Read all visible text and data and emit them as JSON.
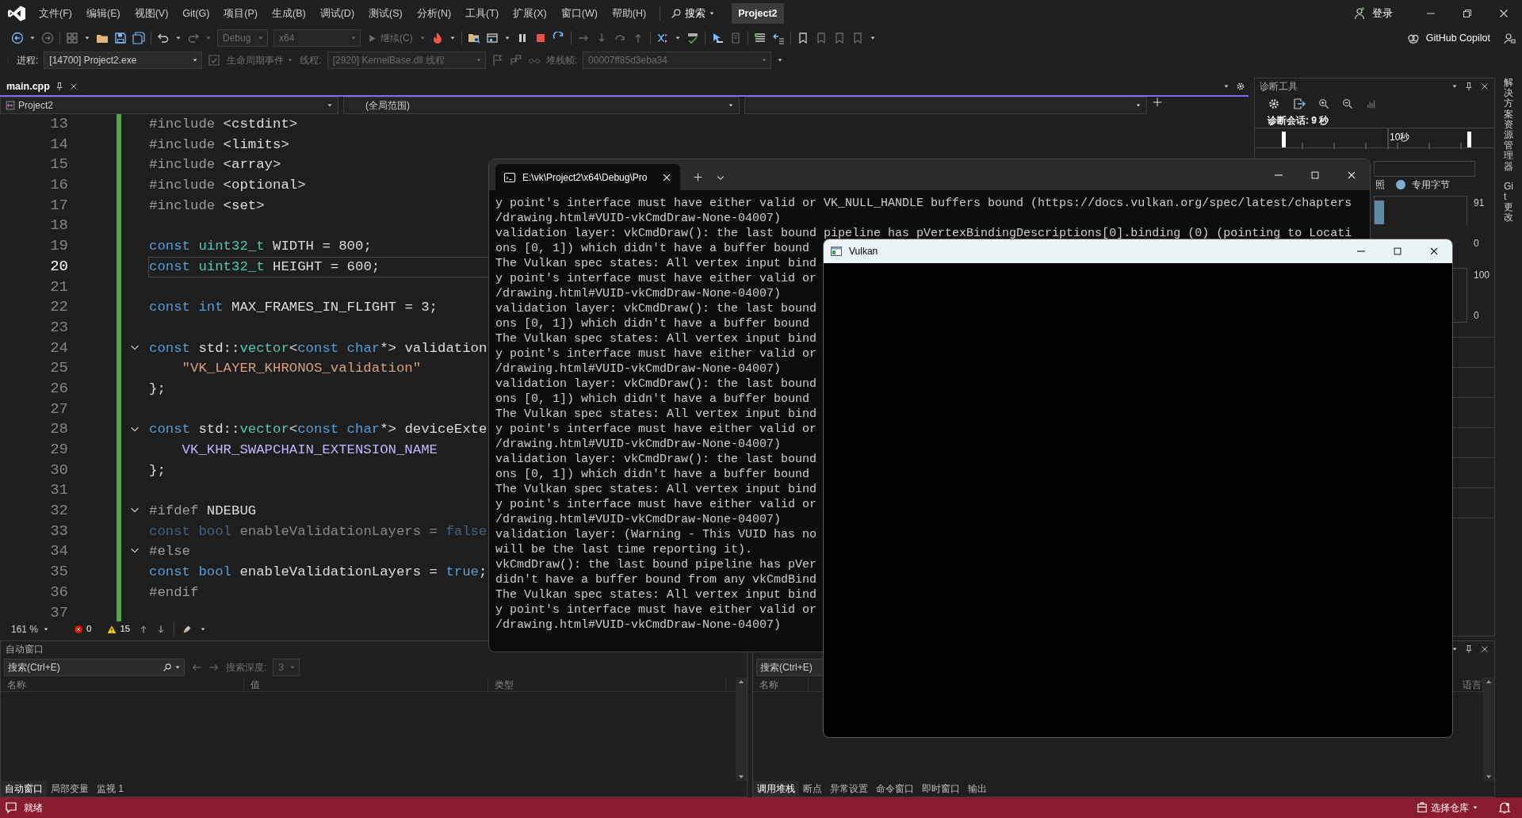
{
  "menu_bar": {
    "items": [
      "文件(F)",
      "编辑(E)",
      "视图(V)",
      "Git(G)",
      "项目(P)",
      "生成(B)",
      "调试(D)",
      "测试(S)",
      "分析(N)",
      "工具(T)",
      "扩展(X)",
      "窗口(W)",
      "帮助(H)"
    ],
    "search": "搜索",
    "solution": "Project2",
    "sign_in": "登录"
  },
  "toolbar": {
    "configuration": "Debug",
    "platform": "x64",
    "continue": "继续(C)",
    "copilot": "GitHub Copilot"
  },
  "debug_location": {
    "process_label": "进程:",
    "process": "[14700] Project2.exe",
    "lifecycle": "生命周期事件",
    "thread_label": "线程:",
    "thread": "[2920] KernelBase.dll 线程",
    "stack_label": "堆栈帧:",
    "stack_frame": "00007ff85d3eba34"
  },
  "editor": {
    "tabs": [
      {
        "label": "main.cpp",
        "selected": true
      }
    ],
    "navigation": {
      "project": "Project2",
      "scope": "(全局范围)"
    },
    "lines": [
      {
        "number": "13",
        "current": false,
        "fold": false,
        "inactive": false,
        "tokens": [
          {
            "kind": "preproc",
            "text": "#include"
          },
          {
            "kind": "plain",
            "text": " <cstdint>"
          }
        ]
      },
      {
        "number": "14",
        "current": false,
        "fold": false,
        "inactive": false,
        "tokens": [
          {
            "kind": "preproc",
            "text": "#include"
          },
          {
            "kind": "plain",
            "text": " <limits>"
          }
        ]
      },
      {
        "number": "15",
        "current": false,
        "fold": false,
        "inactive": false,
        "tokens": [
          {
            "kind": "preproc",
            "text": "#include"
          },
          {
            "kind": "plain",
            "text": " <array>"
          }
        ]
      },
      {
        "number": "16",
        "current": false,
        "fold": false,
        "inactive": false,
        "tokens": [
          {
            "kind": "preproc",
            "text": "#include"
          },
          {
            "kind": "plain",
            "text": " <optional>"
          }
        ]
      },
      {
        "number": "17",
        "current": false,
        "fold": false,
        "inactive": false,
        "tokens": [
          {
            "kind": "preproc",
            "text": "#include"
          },
          {
            "kind": "plain",
            "text": " <set>"
          }
        ]
      },
      {
        "number": "18",
        "current": false,
        "fold": false,
        "inactive": false
      },
      {
        "number": "19",
        "current": false,
        "fold": false,
        "inactive": false,
        "tokens": [
          {
            "kind": "keyword",
            "text": "const"
          },
          {
            "kind": "type",
            "text": " uint32_t"
          },
          {
            "kind": "plain",
            "text": " WIDTH = 800;"
          }
        ]
      },
      {
        "number": "20",
        "current": true,
        "fold": false,
        "inactive": false,
        "tokens": [
          {
            "kind": "keyword",
            "text": "const"
          },
          {
            "kind": "type",
            "text": " uint32_t"
          },
          {
            "kind": "plain",
            "text": " HEIGHT = 600;"
          }
        ]
      },
      {
        "number": "21",
        "current": false,
        "fold": false,
        "inactive": false
      },
      {
        "number": "22",
        "current": false,
        "fold": false,
        "inactive": false,
        "tokens": [
          {
            "kind": "keyword",
            "text": "const"
          },
          {
            "kind": "keyword",
            "text": " int"
          },
          {
            "kind": "plain",
            "text": " MAX_FRAMES_IN_FLIGHT = 3;"
          }
        ]
      },
      {
        "number": "23",
        "current": false,
        "fold": false,
        "inactive": false
      },
      {
        "number": "24",
        "current": false,
        "fold": true,
        "inactive": false,
        "tokens": [
          {
            "kind": "keyword",
            "text": "const"
          },
          {
            "kind": "plain",
            "text": " std::"
          },
          {
            "kind": "type",
            "text": "vector"
          },
          {
            "kind": "plain",
            "text": "<"
          },
          {
            "kind": "keyword",
            "text": "const"
          },
          {
            "kind": "keyword",
            "text": " char"
          },
          {
            "kind": "plain",
            "text": "*> validation"
          }
        ]
      },
      {
        "number": "25",
        "current": false,
        "fold": false,
        "inactive": false,
        "tokens": [
          {
            "kind": "string",
            "text": "    \"VK_LAYER_KHRONOS_validation\""
          }
        ]
      },
      {
        "number": "26",
        "current": false,
        "fold": false,
        "inactive": false,
        "tokens": [
          {
            "kind": "plain",
            "text": "};"
          }
        ]
      },
      {
        "number": "27",
        "current": false,
        "fold": false,
        "inactive": false
      },
      {
        "number": "28",
        "current": false,
        "fold": true,
        "inactive": false,
        "tokens": [
          {
            "kind": "keyword",
            "text": "const"
          },
          {
            "kind": "plain",
            "text": " std::"
          },
          {
            "kind": "type",
            "text": "vector"
          },
          {
            "kind": "plain",
            "text": "<"
          },
          {
            "kind": "keyword",
            "text": "const"
          },
          {
            "kind": "keyword",
            "text": " char"
          },
          {
            "kind": "plain",
            "text": "*> deviceExte"
          }
        ]
      },
      {
        "number": "29",
        "current": false,
        "fold": false,
        "inactive": false,
        "tokens": [
          {
            "kind": "macro",
            "text": "    VK_KHR_SWAPCHAIN_EXTENSION_NAME"
          }
        ]
      },
      {
        "number": "30",
        "current": false,
        "fold": false,
        "inactive": false,
        "tokens": [
          {
            "kind": "plain",
            "text": "};"
          }
        ]
      },
      {
        "number": "31",
        "current": false,
        "fold": false,
        "inactive": false
      },
      {
        "number": "32",
        "current": false,
        "fold": true,
        "inactive": false,
        "tokens": [
          {
            "kind": "preproc",
            "text": "#ifdef"
          },
          {
            "kind": "plain",
            "text": " NDEBUG"
          }
        ]
      },
      {
        "number": "33",
        "current": false,
        "fold": false,
        "inactive": true,
        "tokens": [
          {
            "kind": "keyword",
            "text": "const"
          },
          {
            "kind": "keyword",
            "text": " bool"
          },
          {
            "kind": "plain",
            "text": " enableValidationLayers = "
          },
          {
            "kind": "keyword",
            "text": "false"
          }
        ]
      },
      {
        "number": "34",
        "current": false,
        "fold": true,
        "inactive": false,
        "tokens": [
          {
            "kind": "preproc",
            "text": "#else"
          }
        ]
      },
      {
        "number": "35",
        "current": false,
        "fold": false,
        "inactive": false,
        "tokens": [
          {
            "kind": "keyword",
            "text": "const"
          },
          {
            "kind": "keyword",
            "text": " bool"
          },
          {
            "kind": "plain",
            "text": " enableValidationLayers = "
          },
          {
            "kind": "keyword",
            "text": "true"
          },
          {
            "kind": "plain",
            "text": ";"
          }
        ]
      },
      {
        "number": "36",
        "current": false,
        "fold": false,
        "inactive": false,
        "tokens": [
          {
            "kind": "preproc",
            "text": "#endif"
          }
        ]
      },
      {
        "number": "37",
        "current": false,
        "fold": false,
        "inactive": false
      }
    ],
    "zoom": "161 %",
    "errors": "0",
    "warnings": "15"
  },
  "diagnostic_tools": {
    "title": "诊断工具",
    "session": "诊断会话: 9 秒",
    "ruler_label": "10秒",
    "legend_1": "照",
    "legend_2": "专用字节",
    "chart_1": {
      "top_label": "91",
      "bottom_label": "0"
    },
    "chart_2": {
      "top_label": "100",
      "bottom_label": "0"
    }
  },
  "autos_panel": {
    "title": "自动窗口",
    "placeholder": "搜索(Ctrl+E)",
    "depth_label": "搜索深度:",
    "depth": "3",
    "columns": [
      "名称",
      "值",
      "类型"
    ],
    "tabs": [
      {
        "label": "自动窗口",
        "selected": true
      },
      {
        "label": "局部变量",
        "selected": false
      },
      {
        "label": "监视 1",
        "selected": false
      }
    ]
  },
  "call_stack_panel": {
    "placeholder": "搜索(Ctrl+E)",
    "columns": [
      "名称",
      "语言"
    ],
    "tabs": [
      {
        "label": "调用堆栈",
        "selected": true
      },
      {
        "label": "断点",
        "selected": false
      },
      {
        "label": "异常设置",
        "selected": false
      },
      {
        "label": "命令窗口",
        "selected": false
      },
      {
        "label": "即时窗口",
        "selected": false
      },
      {
        "label": "输出",
        "selected": false
      }
    ]
  },
  "side_tabs": [
    "解决方案资源管理器",
    "Git 更改"
  ],
  "status_bar": {
    "text": "就绪",
    "repository": "选择仓库"
  },
  "console_window": {
    "tab_title": "E:\\vk\\Project2\\x64\\Debug\\Pro",
    "lines": [
      "y point's interface must have either valid or VK_NULL_HANDLE buffers bound (https://docs.vulkan.org/spec/latest/chapters",
      "/drawing.html#VUID-vkCmdDraw-None-04007)",
      "validation layer: vkCmdDraw(): the last bound pipeline has pVertexBindingDescriptions[0].binding (0) (pointing to Locati",
      "ons [0, 1]) which didn't have a buffer bound",
      "The Vulkan spec states: All vertex input bind",
      "y point's interface must have either valid or",
      "/drawing.html#VUID-vkCmdDraw-None-04007)",
      "validation layer: vkCmdDraw(): the last bound",
      "ons [0, 1]) which didn't have a buffer bound",
      "The Vulkan spec states: All vertex input bind",
      "y point's interface must have either valid or",
      "/drawing.html#VUID-vkCmdDraw-None-04007)",
      "validation layer: vkCmdDraw(): the last bound",
      "ons [0, 1]) which didn't have a buffer bound",
      "The Vulkan spec states: All vertex input bind",
      "y point's interface must have either valid or",
      "/drawing.html#VUID-vkCmdDraw-None-04007)",
      "validation layer: vkCmdDraw(): the last bound",
      "ons [0, 1]) which didn't have a buffer bound",
      "The Vulkan spec states: All vertex input bind",
      "y point's interface must have either valid or",
      "/drawing.html#VUID-vkCmdDraw-None-04007)",
      "validation layer: (Warning - This VUID has no",
      "will be the last time reporting it).",
      "vkCmdDraw(): the last bound pipeline has pVer",
      "didn't have a buffer bound from any vkCmdBind",
      "The Vulkan spec states: All vertex input bind",
      "y point's interface must have either valid or",
      "/drawing.html#VUID-vkCmdDraw-None-04007)"
    ]
  },
  "vulkan_window": {
    "title": "Vulkan"
  }
}
